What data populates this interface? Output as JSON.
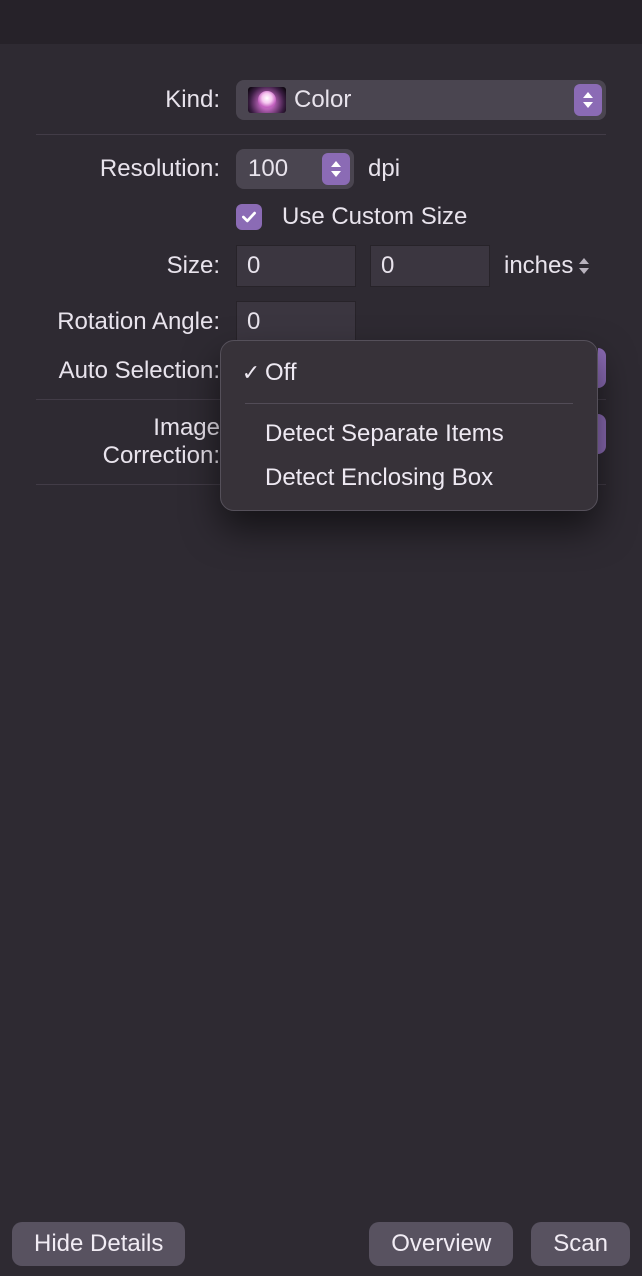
{
  "form": {
    "kind": {
      "label": "Kind:",
      "value": "Color"
    },
    "resolution": {
      "label": "Resolution:",
      "value": "100",
      "unit": "dpi"
    },
    "custom_size": {
      "label": "Use Custom Size",
      "checked": true
    },
    "size": {
      "label": "Size:",
      "width": "0",
      "height": "0",
      "unit": "inches"
    },
    "rotation": {
      "label": "Rotation Angle:",
      "value": "0"
    },
    "auto_selection": {
      "label": "Auto Selection:",
      "selected": "Off",
      "options": [
        "Off",
        "Detect Separate Items",
        "Detect Enclosing Box"
      ]
    },
    "image_correction": {
      "label": "Image Correction:"
    }
  },
  "footer": {
    "hide_details": "Hide Details",
    "overview": "Overview",
    "scan": "Scan"
  }
}
